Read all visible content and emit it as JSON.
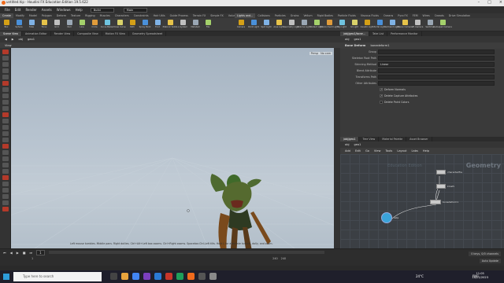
{
  "window": {
    "title": "untitled.hip - Houdini FX Education Edition 19.5.622"
  },
  "menu": {
    "items": [
      "File",
      "Edit",
      "Render",
      "Assets",
      "Windows",
      "Help"
    ],
    "desktop": "Build",
    "context": "Main"
  },
  "shelf_left": {
    "tabs": [
      "Create",
      "Modify",
      "Model",
      "Polygon",
      "Deform",
      "Texture",
      "Rigging",
      "Muscles",
      "Characters",
      "Constraints",
      "Hair Utils",
      "Guide Process",
      "Terrain FX",
      "Simple FX",
      "Volume"
    ],
    "tools": [
      "Box",
      "Sphere",
      "Tube",
      "Torus",
      "Grid",
      "Null",
      "Line",
      "Circle",
      "Curve Bézier",
      "Draw Curve",
      "Path",
      "Spray Paint",
      "Font",
      "Platonic Solids",
      "L-System",
      "Metaball",
      "File"
    ]
  },
  "shelf_right": {
    "tabs": [
      "Lights and...",
      "Collisions",
      "Particles",
      "Grains",
      "Vellum",
      "Rigid Bodies",
      "Particle Fluids",
      "Viscous Fluids",
      "Oceans",
      "Pyro FX",
      "FEM",
      "Wires",
      "Crowds",
      "Drive Simulation"
    ],
    "tools": [
      "Camera",
      "Point Light",
      "Spot Light",
      "Area Light",
      "Geometry Light",
      "Volume Light",
      "Distant Light",
      "Environment Light",
      "Sky Light",
      "GI Light",
      "Caustic Light",
      "Portal Light",
      "Ambient Light",
      "Stereo Camera",
      "VR Camera",
      "Switcher",
      "Gamepad Camera"
    ]
  },
  "pane_tabs": [
    "Scene View",
    "Animation Editor",
    "Render View",
    "Composite View",
    "Motion FX View",
    "Geometry Spreadsheet"
  ],
  "path": {
    "obj": "obj",
    "node": "geo1"
  },
  "view": {
    "label": "View",
    "persp": "Persp",
    "cam": "No cam"
  },
  "viewport": {
    "status": "Left mouse tumbles. Middle pans. Right dollies. Ctrl+Alt+Left box zooms. Ctrl+Right zooms. Spacebar-Ctrl-Left tilts. Hold L for alternate tumble, dolly, and zoom."
  },
  "timeline": {
    "frame": "1",
    "start": "1",
    "end": "240",
    "end2": "240"
  },
  "right_tabs": [
    "/obj/geo1/bone...",
    "Take List",
    "Performance Monitor"
  ],
  "params": {
    "node_type": "Bone Deform",
    "node_name": "bonedeform1",
    "rows": [
      {
        "label": "Group",
        "value": ""
      },
      {
        "label": "Skeleton Root Path",
        "value": ""
      },
      {
        "label": "Skinning Method",
        "value": "Linear"
      },
      {
        "label": "Blend Attribute",
        "value": ""
      },
      {
        "label": "Transforms Path",
        "value": ""
      },
      {
        "label": "Other Attributes",
        "value": ""
      }
    ],
    "checks": [
      {
        "label": "Deform Normals",
        "checked": true
      },
      {
        "label": "Delete Capture Attributes",
        "checked": true
      },
      {
        "label": "Delete Point Colors",
        "checked": false
      }
    ]
  },
  "net_tabs": [
    "/obj/geo1",
    "Tree View",
    "Material Palette",
    "Asset Browser"
  ],
  "net_menu": [
    "Add",
    "Edit",
    "Go",
    "View",
    "Tools",
    "Layout",
    "Labs",
    "Help"
  ],
  "network": {
    "context_label": "Geometry",
    "watermark": "Education Edition",
    "nodes": [
      "characterfile",
      "kinefx",
      "bonedeform1",
      "labs"
    ]
  },
  "net_bottom": {
    "keys": "0 keys, 0/0 channels",
    "auto_update": "Auto Update"
  },
  "taskbar": {
    "search_placeholder": "Type here to search",
    "weather": "24°C",
    "lang": "ENG",
    "time": "11:05",
    "date": "18/01/2023"
  },
  "colors": {
    "accent_orange": "#f06a1c",
    "node_blue": "#3aa3d9",
    "viewport_top": "#a6b4c2",
    "viewport_bottom": "#c2ccd5"
  }
}
